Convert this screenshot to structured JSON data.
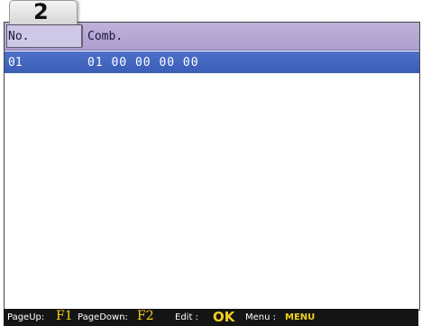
{
  "badge": {
    "number": "2"
  },
  "table": {
    "headers": {
      "no": "No.",
      "comb": "Comb."
    },
    "rows": [
      {
        "no": "01",
        "comb": "01 00 00 00 00"
      }
    ]
  },
  "footer": {
    "page_up_label": "PageUp:",
    "page_up_key": "F1",
    "page_down_label": "PageDown:",
    "page_down_key": "F2",
    "edit_label": "Edit :",
    "edit_key": "OK",
    "menu_label": "Menu :",
    "menu_key": "MENU"
  },
  "colors": {
    "header_bg": "#b4a6d4",
    "selected_row_bg": "#4466bf",
    "footer_bg": "#151515",
    "key_highlight": "#f2d11d"
  }
}
